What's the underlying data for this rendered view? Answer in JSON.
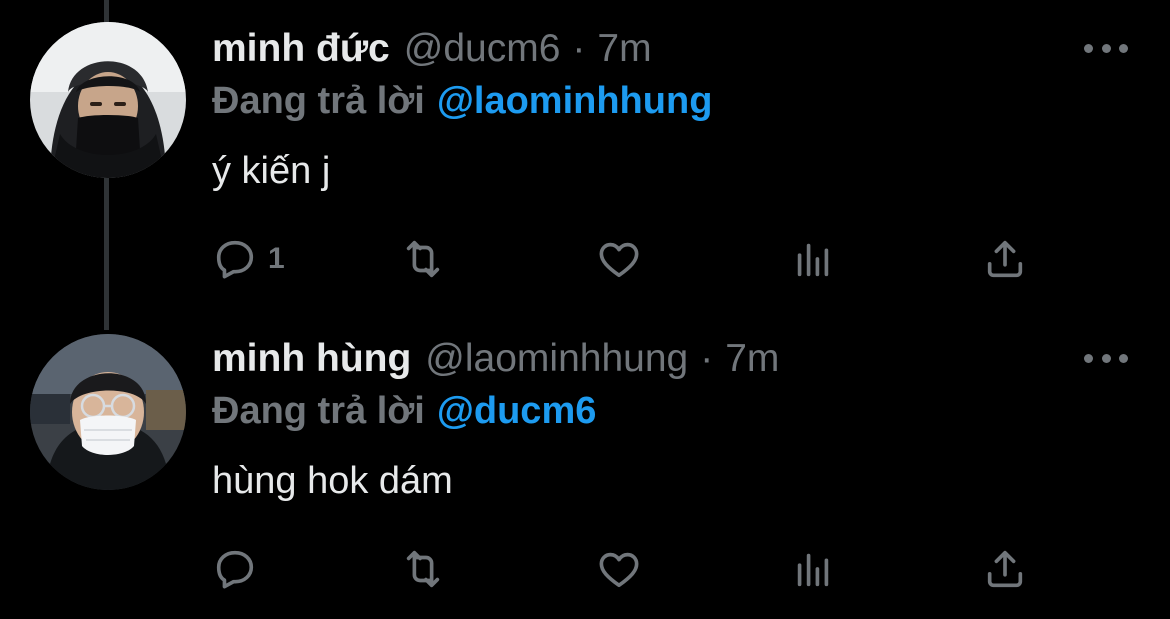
{
  "colors": {
    "background": "#000000",
    "primary_text": "#e7e9ea",
    "secondary_text": "#71767b",
    "accent": "#1d9bf0",
    "thread_line": "#2f3336"
  },
  "tweets": [
    {
      "display_name": "minh đức",
      "handle": "@ducm6",
      "separator": "·",
      "time": "7m",
      "reply_prefix": "Đang trả lời",
      "reply_to": "@laominhhung",
      "text": "ý kiến j",
      "reply_count": "1",
      "avatar_icon": "avatar-photo",
      "icons": [
        "reply-icon",
        "retweet-icon",
        "like-icon",
        "analytics-icon",
        "share-icon",
        "more-icon"
      ]
    },
    {
      "display_name": "minh hùng",
      "handle": "@laominhhung",
      "separator": "·",
      "time": "7m",
      "reply_prefix": "Đang trả lời",
      "reply_to": "@ducm6",
      "text": "hùng hok dám",
      "reply_count": "",
      "avatar_icon": "avatar-photo",
      "icons": [
        "reply-icon",
        "retweet-icon",
        "like-icon",
        "analytics-icon",
        "share-icon",
        "more-icon"
      ]
    }
  ]
}
